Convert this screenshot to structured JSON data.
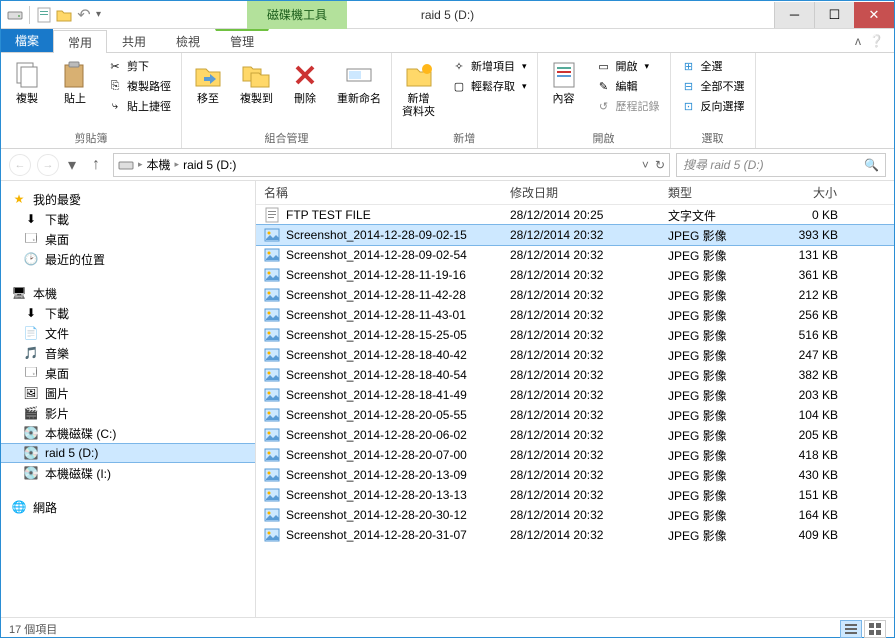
{
  "window": {
    "title": "raid 5 (D:)",
    "contextual_tab_header": "磁碟機工具"
  },
  "tabs": {
    "file": "檔案",
    "home": "常用",
    "share": "共用",
    "view": "檢視",
    "manage": "管理",
    "help_glyph": "ʌ",
    "help_icon": "❓"
  },
  "ribbon": {
    "clipboard": {
      "label": "剪貼簿",
      "copy": "複製",
      "paste": "貼上",
      "cut": "剪下",
      "copy_path": "複製路徑",
      "paste_shortcut": "貼上捷徑"
    },
    "organize": {
      "label": "組合管理",
      "move_to": "移至",
      "copy_to": "複製到",
      "delete": "刪除",
      "rename": "重新命名"
    },
    "new": {
      "label": "新增",
      "new_folder": "新增\n資料夾",
      "new_item": "新增項目",
      "easy_access": "輕鬆存取"
    },
    "open": {
      "label": "開啟",
      "properties": "內容",
      "open": "開啟",
      "edit": "編輯",
      "history": "歷程記錄"
    },
    "select": {
      "label": "選取",
      "select_all": "全選",
      "select_none": "全部不選",
      "invert": "反向選擇"
    }
  },
  "address": {
    "root": "本機",
    "current": "raid 5 (D:)",
    "refresh_icon": "↻",
    "dropdown_icon": "˅"
  },
  "search": {
    "placeholder": "搜尋 raid 5 (D:)"
  },
  "navpane": {
    "favorites": {
      "label": "我的最愛",
      "items": [
        "下載",
        "桌面",
        "最近的位置"
      ]
    },
    "computer": {
      "label": "本機",
      "items": [
        "下載",
        "文件",
        "音樂",
        "桌面",
        "圖片",
        "影片",
        "本機磁碟 (C:)",
        "raid 5 (D:)",
        "本機磁碟 (I:)"
      ]
    },
    "network": {
      "label": "網路"
    }
  },
  "columns": {
    "name": "名稱",
    "date": "修改日期",
    "type": "類型",
    "size": "大小"
  },
  "files": [
    {
      "name": "FTP TEST FILE",
      "date": "28/12/2014 20:25",
      "type": "文字文件",
      "size": "0 KB",
      "icon": "txt"
    },
    {
      "name": "Screenshot_2014-12-28-09-02-15",
      "date": "28/12/2014 20:32",
      "type": "JPEG 影像",
      "size": "393 KB",
      "icon": "img",
      "selected": true
    },
    {
      "name": "Screenshot_2014-12-28-09-02-54",
      "date": "28/12/2014 20:32",
      "type": "JPEG 影像",
      "size": "131 KB",
      "icon": "img"
    },
    {
      "name": "Screenshot_2014-12-28-11-19-16",
      "date": "28/12/2014 20:32",
      "type": "JPEG 影像",
      "size": "361 KB",
      "icon": "img"
    },
    {
      "name": "Screenshot_2014-12-28-11-42-28",
      "date": "28/12/2014 20:32",
      "type": "JPEG 影像",
      "size": "212 KB",
      "icon": "img"
    },
    {
      "name": "Screenshot_2014-12-28-11-43-01",
      "date": "28/12/2014 20:32",
      "type": "JPEG 影像",
      "size": "256 KB",
      "icon": "img"
    },
    {
      "name": "Screenshot_2014-12-28-15-25-05",
      "date": "28/12/2014 20:32",
      "type": "JPEG 影像",
      "size": "516 KB",
      "icon": "img"
    },
    {
      "name": "Screenshot_2014-12-28-18-40-42",
      "date": "28/12/2014 20:32",
      "type": "JPEG 影像",
      "size": "247 KB",
      "icon": "img"
    },
    {
      "name": "Screenshot_2014-12-28-18-40-54",
      "date": "28/12/2014 20:32",
      "type": "JPEG 影像",
      "size": "382 KB",
      "icon": "img"
    },
    {
      "name": "Screenshot_2014-12-28-18-41-49",
      "date": "28/12/2014 20:32",
      "type": "JPEG 影像",
      "size": "203 KB",
      "icon": "img"
    },
    {
      "name": "Screenshot_2014-12-28-20-05-55",
      "date": "28/12/2014 20:32",
      "type": "JPEG 影像",
      "size": "104 KB",
      "icon": "img"
    },
    {
      "name": "Screenshot_2014-12-28-20-06-02",
      "date": "28/12/2014 20:32",
      "type": "JPEG 影像",
      "size": "205 KB",
      "icon": "img"
    },
    {
      "name": "Screenshot_2014-12-28-20-07-00",
      "date": "28/12/2014 20:32",
      "type": "JPEG 影像",
      "size": "418 KB",
      "icon": "img"
    },
    {
      "name": "Screenshot_2014-12-28-20-13-09",
      "date": "28/12/2014 20:32",
      "type": "JPEG 影像",
      "size": "430 KB",
      "icon": "img"
    },
    {
      "name": "Screenshot_2014-12-28-20-13-13",
      "date": "28/12/2014 20:32",
      "type": "JPEG 影像",
      "size": "151 KB",
      "icon": "img"
    },
    {
      "name": "Screenshot_2014-12-28-20-30-12",
      "date": "28/12/2014 20:32",
      "type": "JPEG 影像",
      "size": "164 KB",
      "icon": "img"
    },
    {
      "name": "Screenshot_2014-12-28-20-31-07",
      "date": "28/12/2014 20:32",
      "type": "JPEG 影像",
      "size": "409 KB",
      "icon": "img"
    }
  ],
  "status": {
    "item_count": "17 個項目"
  }
}
